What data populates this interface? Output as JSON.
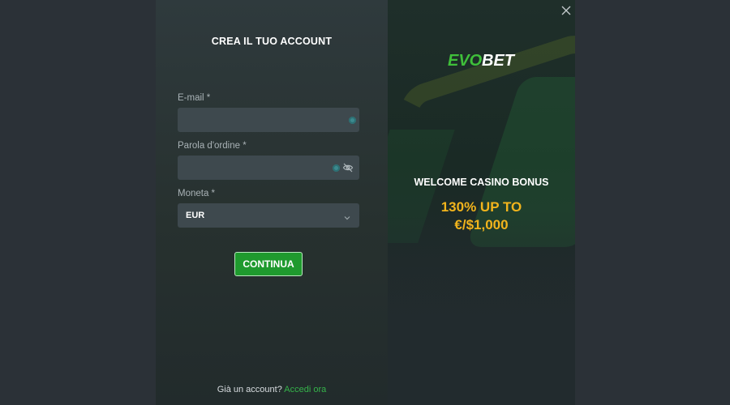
{
  "form": {
    "title": "CREA IL TUO ACCOUNT",
    "email_label": "E-mail *",
    "email_value": "",
    "email_placeholder": "",
    "password_label": "Parola d'ordine *",
    "password_value": "",
    "password_placeholder": "",
    "currency_label": "Moneta *",
    "currency_value": "EUR",
    "submit_label": "CONTINUA",
    "footer_text": "Già un account?",
    "footer_link": "Accedi ora"
  },
  "promo": {
    "logo_text_evo": "EVO",
    "logo_text_bet": "BET",
    "heading": "WELCOME CASINO BONUS",
    "offer_line1": "130% UP TO",
    "offer_line2": "€/$1,000"
  },
  "colors": {
    "accent_green": "#1f9a2e",
    "link_green": "#35b34a",
    "offer_yellow": "#f2b41c"
  },
  "icons": {
    "close": "close-icon",
    "email_status": "status-dot-icon",
    "password_status": "status-dot-icon",
    "password_toggle": "eye-off-icon",
    "select_arrow": "chevron-down-icon"
  }
}
